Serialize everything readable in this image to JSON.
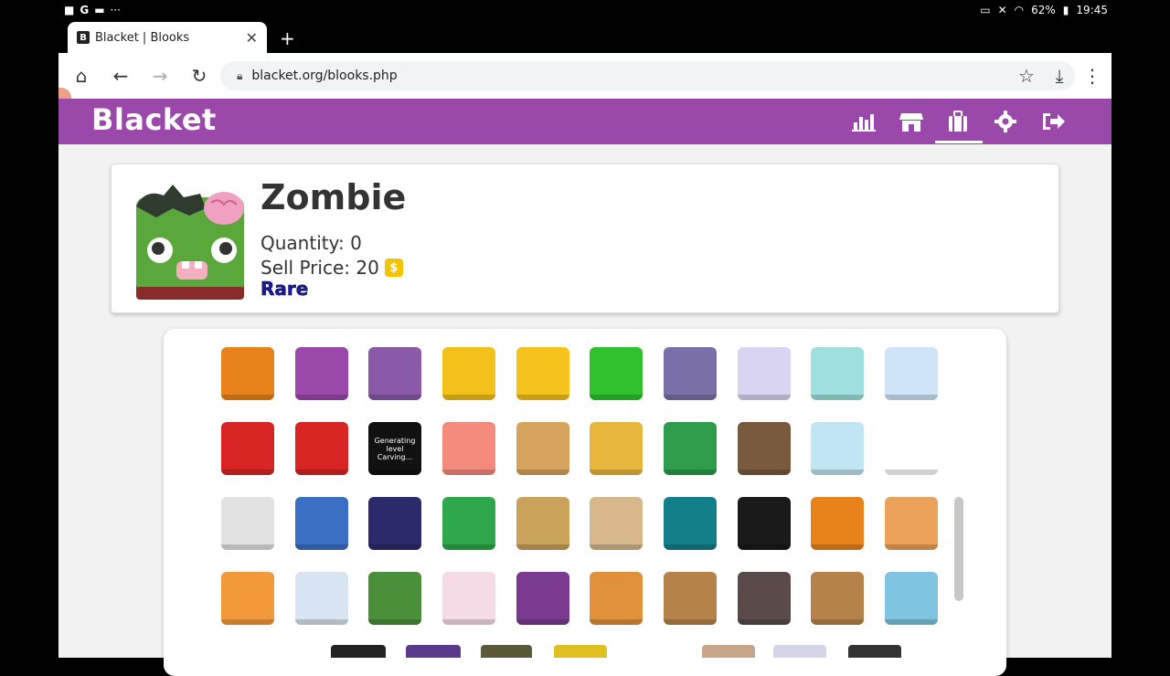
{
  "status_bar": {
    "left_icons": [
      "camera-icon",
      "google-icon",
      "folder-icon",
      "more-icon"
    ],
    "battery": "62%",
    "time": "19:45"
  },
  "browser": {
    "tab_title": "Blacket | Blooks",
    "tab_favicon": "B",
    "url": "blacket.org/blooks.php",
    "new_tab": "+"
  },
  "header": {
    "logo": "Blacket",
    "nav": [
      "stats-icon",
      "market-icon",
      "blooks-icon",
      "settings-icon",
      "logout-icon"
    ],
    "active": "blooks-icon",
    "colors": {
      "header": "#9a49aa"
    }
  },
  "selected_blook": {
    "name": "Zombie",
    "quantity_label": "Quantity: 0",
    "sell_price_label": "Sell Price: 20",
    "coin_symbol": "$",
    "rarity": "Rare",
    "rarity_color": "#1a1aa8"
  },
  "blook_grid": {
    "rows": [
      [
        {
          "name": "pumpkin",
          "color": "#e8821b"
        },
        {
          "name": "purple-plain",
          "color": "#9a49aa"
        },
        {
          "name": "retro-tv-purple",
          "color": "#8a5aa8"
        },
        {
          "name": "yellow-bot",
          "color": "#f2c21b"
        },
        {
          "name": "red-cheek-yellow",
          "color": "#f6c21c"
        },
        {
          "name": "green-plain",
          "color": "#2ec22e"
        },
        {
          "name": "retro-tv-gray",
          "color": "#7b6fa8"
        },
        {
          "name": "rainbow-cloud",
          "color": "#d9d4f2"
        },
        {
          "name": "narwhal",
          "color": "#9fe0df"
        },
        {
          "name": "panda-rainbow",
          "color": "#cfe5f7"
        }
      ],
      [
        {
          "name": "red-plain",
          "color": "#d92424"
        },
        {
          "name": "retro-tv-red",
          "color": "#d92424"
        },
        {
          "name": "generating-screen",
          "color": "#111111",
          "label": "Generating level Carving..."
        },
        {
          "name": "salmon-plain",
          "color": "#f48a7a"
        },
        {
          "name": "sandwich",
          "color": "#d6a35c"
        },
        {
          "name": "santa",
          "color": "#e8b63c"
        },
        {
          "name": "green-creeper",
          "color": "#2e9c4a"
        },
        {
          "name": "sloth",
          "color": "#7a5a3c"
        },
        {
          "name": "snow-globe",
          "color": "#bfe6f2"
        },
        {
          "name": "snowman",
          "color": "#ffffff"
        }
      ],
      [
        {
          "name": "space-console",
          "color": "#e2e2e2"
        },
        {
          "name": "rocket",
          "color": "#3a6fc4"
        },
        {
          "name": "night-sky",
          "color": "#2b2a6b"
        },
        {
          "name": "swamp-monster",
          "color": "#2ea84a"
        },
        {
          "name": "talking-dog",
          "color": "#c9a25b"
        },
        {
          "name": "tan-plain",
          "color": "#d6b88a"
        },
        {
          "name": "teal-plain",
          "color": "#137f8a"
        },
        {
          "name": "chick-black",
          "color": "#1a1a1a"
        },
        {
          "name": "tiger",
          "color": "#e8821b"
        },
        {
          "name": "toast",
          "color": "#eba25a"
        }
      ],
      [
        {
          "name": "tropical-island",
          "color": "#f29a3a"
        },
        {
          "name": "playing-card",
          "color": "#d7e4f2"
        },
        {
          "name": "ufo",
          "color": "#4a8f3a"
        },
        {
          "name": "unicorn",
          "color": "#f5dbe8"
        },
        {
          "name": "vampire",
          "color": "#7a3a8f"
        },
        {
          "name": "waffle",
          "color": "#e0913a"
        },
        {
          "name": "wood-mustache",
          "color": "#b5834a"
        },
        {
          "name": "werewolf",
          "color": "#5a4a4a"
        },
        {
          "name": "wood-mustache-2",
          "color": "#b5834a"
        },
        {
          "name": "peacock",
          "color": "#7fc4e0"
        }
      ]
    ]
  }
}
